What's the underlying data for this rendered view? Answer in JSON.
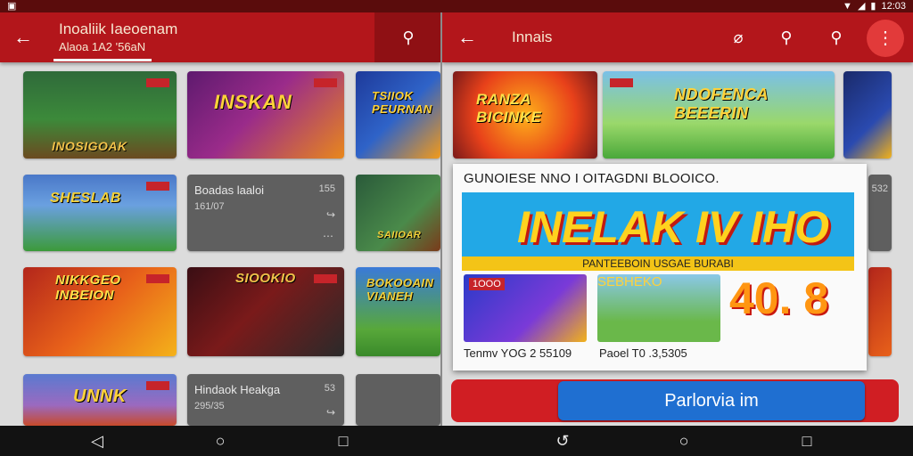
{
  "status": {
    "left_icon": "notification-icon",
    "time": "12:03",
    "icons": [
      "wifi-icon",
      "signal-icon",
      "battery-icon"
    ]
  },
  "left": {
    "title": "Inoaliik Iaeoenam",
    "subtitle": "Alaoa 1A2 '56aN",
    "back_icon": "arrow-back-icon",
    "search_icon": "search-icon",
    "tiles": [
      {
        "label": "INOSIGOAK"
      },
      {
        "label": "INSKAN"
      },
      {
        "label": "TSIIOK PEURNAN"
      },
      {
        "label": "SHESLAB"
      },
      {
        "name": "Boadas laaloi",
        "meta": "161/07",
        "num": "155",
        "share_icon": "share-icon",
        "more_icon": "more-icon"
      },
      {
        "label": "SAIIOAR"
      },
      {
        "label": "NIKKGEO INBEION"
      },
      {
        "label": "SIOOKIO"
      },
      {
        "label": "BOKOOAIN VIANEH"
      },
      {
        "label": "UNNK"
      },
      {
        "name": "Hindaok Heakga",
        "meta": "295/35",
        "num": "53",
        "share_icon": "share-icon",
        "more_icon": "more-icon"
      }
    ]
  },
  "right": {
    "title": "Innais",
    "back_icon": "arrow-back-icon",
    "icons": [
      "tag-icon",
      "search-icon",
      "zoom-icon"
    ],
    "overflow_icon": "overflow-menu-icon",
    "tiles": [
      {
        "label": "RANZA BICINKE"
      },
      {
        "label": "NDOFENCA BEEERIN"
      },
      {
        "num": "532"
      }
    ],
    "popup": {
      "headline": "GUNOIESE NNO I OITAGDNI BLOOICO.",
      "banner_text": "INELAK IV IHO",
      "strip_text": "PANTEEBOIN USGAE BURABI",
      "thumb1_label": "1OOO",
      "thumb2_label": "SEBHEKO",
      "score": "40. 8",
      "caption1": "Tenmv YOG 2 55109",
      "caption2": "Paoel T0 .3,5305"
    },
    "cta_label": "Parlorvia im"
  },
  "nav": {
    "icons": [
      "back-nav-icon",
      "home-nav-icon",
      "recents-nav-icon",
      "back-nav-icon",
      "home-nav-icon",
      "recents-nav-icon"
    ]
  },
  "colors": {
    "appbar": "#b3161b",
    "accent": "#e23a3a",
    "cta": "#1f6fd1",
    "banner": "#22a8e6"
  }
}
